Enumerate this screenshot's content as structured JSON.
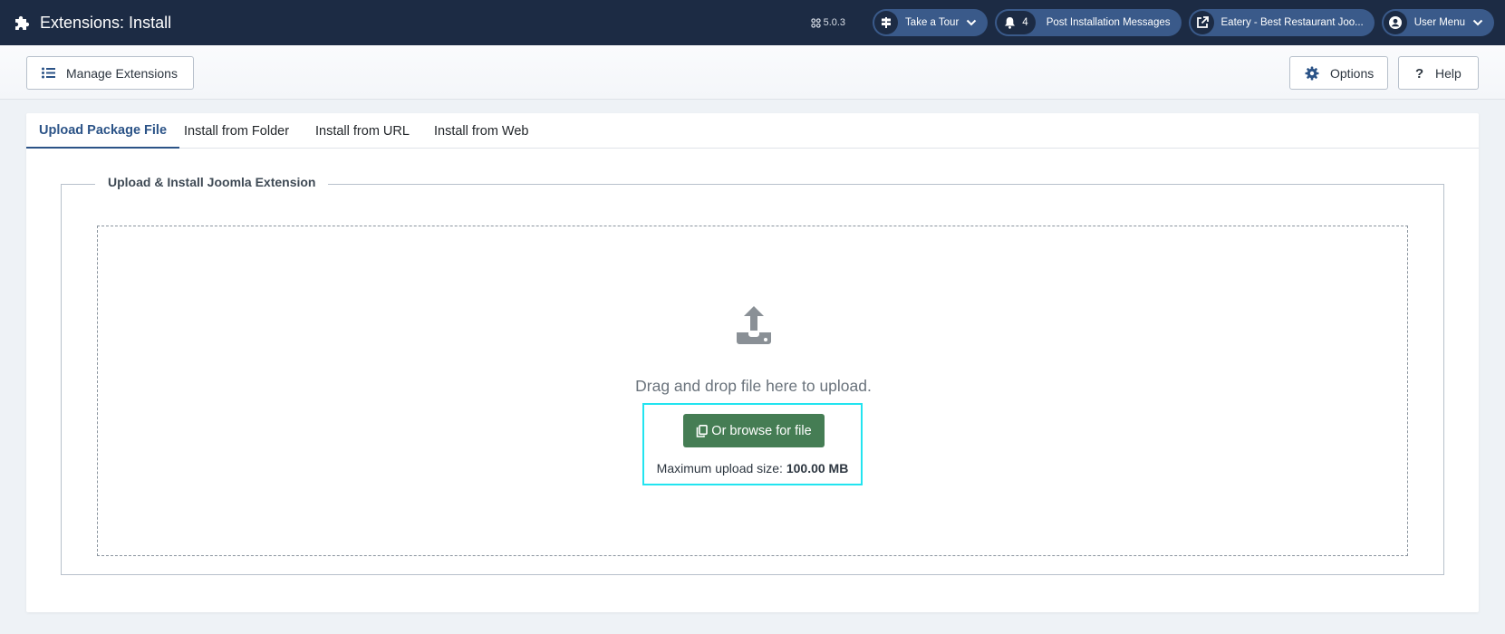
{
  "header": {
    "title": "Extensions: Install",
    "version": "5.0.3",
    "take_tour": "Take a Tour",
    "messages_count": "4",
    "messages_label": "Post Installation Messages",
    "site_label": "Eatery - Best Restaurant Joo...",
    "user_menu": "User Menu"
  },
  "toolbar": {
    "manage_label": "Manage Extensions",
    "options_label": "Options",
    "help_label": "Help"
  },
  "tabs": [
    {
      "label": "Upload Package File",
      "active": true
    },
    {
      "label": "Install from Folder",
      "active": false
    },
    {
      "label": "Install from URL",
      "active": false
    },
    {
      "label": "Install from Web",
      "active": false
    }
  ],
  "upload": {
    "legend": "Upload & Install Joomla Extension",
    "drag_text": "Drag and drop file here to upload.",
    "browse_label": "Or browse for file",
    "max_size_label": "Maximum upload size:",
    "max_size_value": "100.00 MB"
  },
  "colors": {
    "header_bg": "#1c2b44",
    "pill_bg": "#3a5a8a",
    "accent": "#2b5387",
    "browse_button": "#457d54",
    "focus_outline": "#22e4f0"
  },
  "icons": {
    "header": "puzzle-icon",
    "version": "joomla-icon",
    "tour": "signpost-icon",
    "messages": "bell-icon",
    "site": "external-link-icon",
    "user": "user-circle-icon",
    "manage": "list-icon",
    "options": "gear-icon",
    "help": "question-icon",
    "upload": "upload-icon",
    "browse": "copy-icon"
  }
}
